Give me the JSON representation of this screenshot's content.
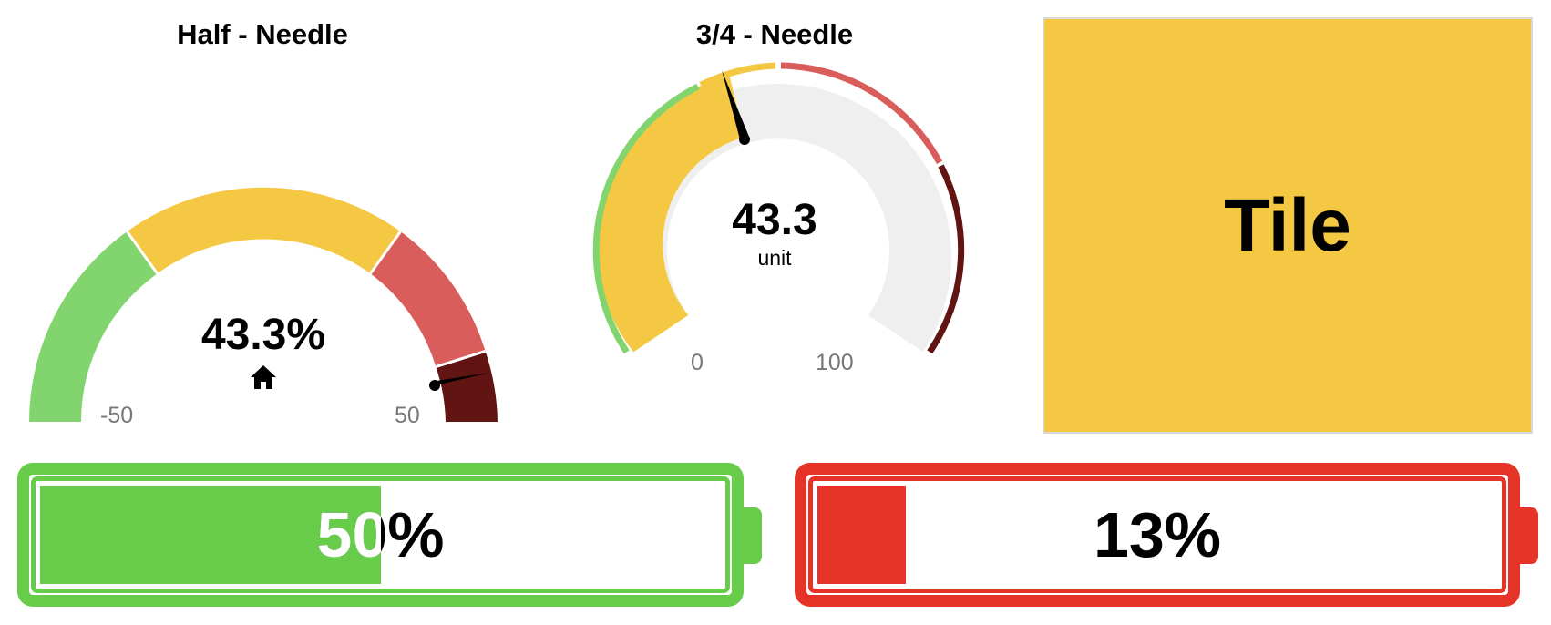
{
  "gauge_half": {
    "title": "Half - Needle",
    "value_text": "43.3%",
    "min_label": "-50",
    "max_label": "50",
    "marker_icon": "home-icon",
    "colors": {
      "green": "#82d46e",
      "yellow": "#f4c843",
      "red": "#d95d5a",
      "dark_red": "#611411"
    }
  },
  "gauge_three_quarter": {
    "title": "3/4 - Needle",
    "value": "43.3",
    "unit": "unit",
    "min_label": "0",
    "max_label": "100",
    "fill_fraction": 0.433,
    "colors": {
      "fill": "#f4c843",
      "track": "#efefef",
      "green": "#82d46e",
      "yellow": "#f4c843",
      "red": "#d95d5a",
      "dark_red": "#611411"
    }
  },
  "tile": {
    "label": "Tile",
    "color": "#f4c843"
  },
  "battery_green": {
    "value_text": "50%",
    "level": 0.5,
    "color": "#66cc4a"
  },
  "battery_red": {
    "value_text": "13%",
    "level": 0.13,
    "color": "#e63327"
  }
}
